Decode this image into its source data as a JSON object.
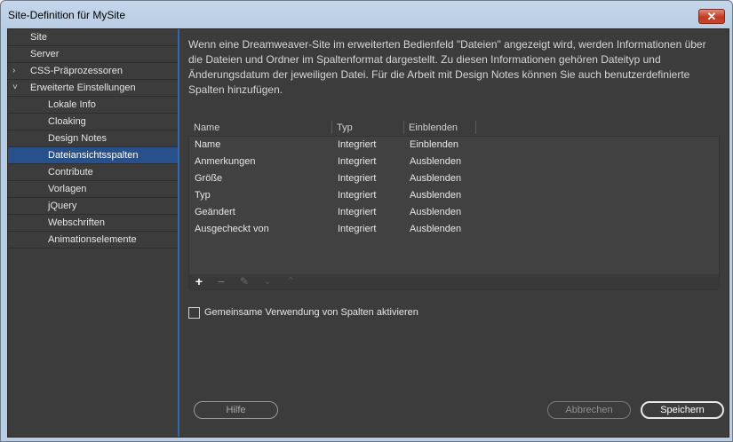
{
  "window": {
    "title": "Site-Definition für MySite",
    "close_glyph": "✕"
  },
  "sidebar": {
    "items": [
      {
        "label": "Site",
        "indent": 0,
        "chevron": "",
        "selected": false
      },
      {
        "label": "Server",
        "indent": 0,
        "chevron": "",
        "selected": false
      },
      {
        "label": "CSS-Präprozessoren",
        "indent": 0,
        "chevron": "›",
        "selected": false
      },
      {
        "label": "Erweiterte Einstellungen",
        "indent": 0,
        "chevron": "˅",
        "selected": false
      },
      {
        "label": "Lokale Info",
        "indent": 1,
        "chevron": "",
        "selected": false
      },
      {
        "label": "Cloaking",
        "indent": 1,
        "chevron": "",
        "selected": false
      },
      {
        "label": "Design Notes",
        "indent": 1,
        "chevron": "",
        "selected": false
      },
      {
        "label": "Dateiansichtsspalten",
        "indent": 1,
        "chevron": "",
        "selected": true
      },
      {
        "label": "Contribute",
        "indent": 1,
        "chevron": "",
        "selected": false
      },
      {
        "label": "Vorlagen",
        "indent": 1,
        "chevron": "",
        "selected": false
      },
      {
        "label": "jQuery",
        "indent": 1,
        "chevron": "",
        "selected": false
      },
      {
        "label": "Webschriften",
        "indent": 1,
        "chevron": "",
        "selected": false
      },
      {
        "label": "Animationselemente",
        "indent": 1,
        "chevron": "",
        "selected": false
      }
    ]
  },
  "main": {
    "description": "Wenn eine Dreamweaver-Site im erweiterten Bedienfeld \"Dateien\" angezeigt wird, werden Informationen über die Dateien und Ordner im Spaltenformat dargestellt. Zu diesen Informationen gehören Dateityp und Änderungsdatum der jeweiligen Datei. Für die Arbeit mit Design Notes können Sie auch benutzerdefinierte Spalten hinzufügen.",
    "table": {
      "columns": [
        "Name",
        "Typ",
        "Einblenden"
      ],
      "rows": [
        [
          "Name",
          "Integriert",
          "Einblenden"
        ],
        [
          "Anmerkungen",
          "Integriert",
          "Ausblenden"
        ],
        [
          "Größe",
          "Integriert",
          "Ausblenden"
        ],
        [
          "Typ",
          "Integriert",
          "Ausblenden"
        ],
        [
          "Geändert",
          "Integriert",
          "Ausblenden"
        ],
        [
          "Ausgecheckt von",
          "Integriert",
          "Ausblenden"
        ]
      ]
    },
    "toolbar": {
      "add_icon": "+",
      "remove_icon": "−",
      "edit_icon": "✎",
      "move_down_icon": "⌄",
      "move_up_icon": "⌃"
    },
    "share_checkbox": {
      "label": "Gemeinsame Verwendung von Spalten aktivieren",
      "checked": false
    }
  },
  "buttons": {
    "help": "Hilfe",
    "cancel": "Abbrechen",
    "save": "Speichern"
  },
  "colors": {
    "accent": "#2c6ab8",
    "selected_bg": "#28508a",
    "panel_bg": "#3c3c3c"
  }
}
